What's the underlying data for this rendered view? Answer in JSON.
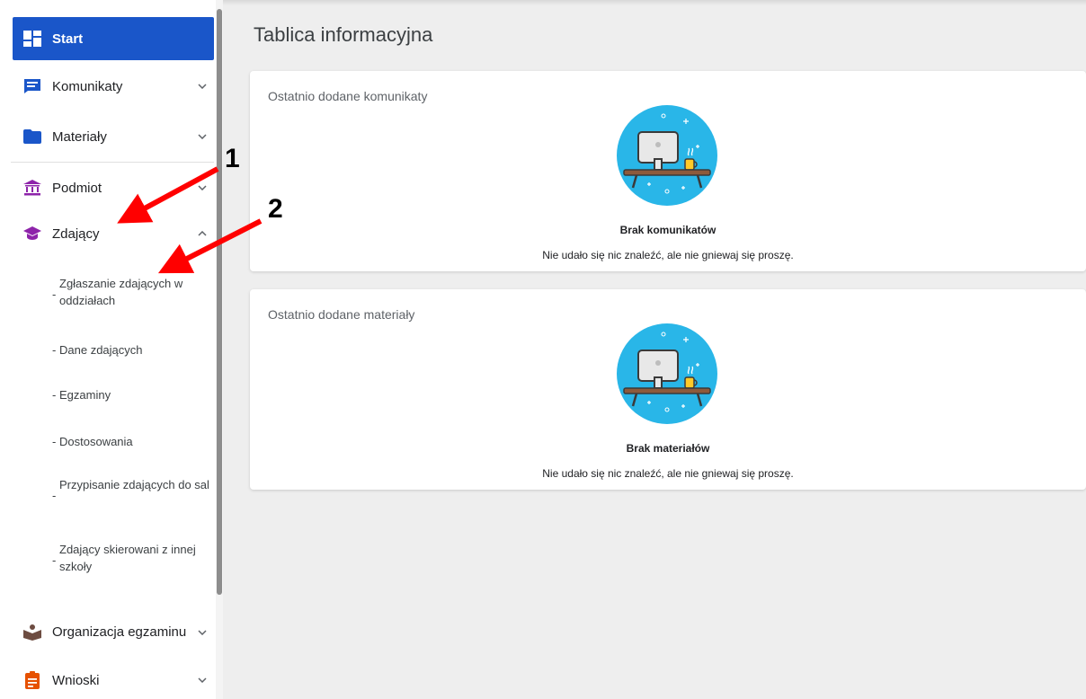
{
  "main": {
    "page_title": "Tablica informacyjna",
    "cards": [
      {
        "title": "Ostatnio dodane komunikaty",
        "empty_title": "Brak komunikatów",
        "empty_desc": "Nie udało się nic znaleźć, ale nie gniewaj się proszę."
      },
      {
        "title": "Ostatnio dodane materiały",
        "empty_title": "Brak materiałów",
        "empty_desc": "Nie udało się nic znaleźć, ale nie gniewaj się proszę."
      }
    ]
  },
  "sidebar": {
    "items": [
      {
        "label": "Start",
        "icon": "dashboard-icon"
      },
      {
        "label": "Komunikaty",
        "icon": "message-icon"
      },
      {
        "label": "Materiały",
        "icon": "folder-icon"
      },
      {
        "label": "Podmiot",
        "icon": "institution-icon"
      },
      {
        "label": "Zdający",
        "icon": "graduation-cap-icon"
      },
      {
        "label": "Organizacja egzaminu",
        "icon": "organization-icon"
      },
      {
        "label": "Wnioski",
        "icon": "clipboard-icon"
      }
    ],
    "sub_items": [
      "Zgłaszanie zdających w oddziałach",
      "Dane zdających",
      "Egzaminy",
      "Dostosowania",
      "Przypisanie zdających do sal",
      "Zdający skierowani z innej szkoły"
    ]
  },
  "annotations": [
    "1",
    "2"
  ],
  "colors": {
    "primary": "#1a56c9",
    "purple": "#8e24aa",
    "icon_circle": "#29b6e8",
    "annotation_arrow": "#ff0000"
  }
}
